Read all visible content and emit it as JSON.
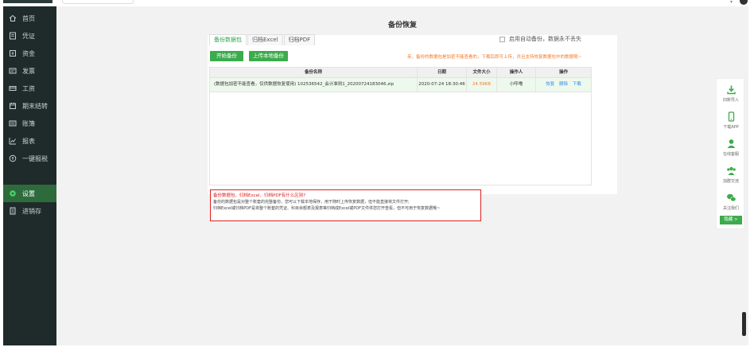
{
  "sidebar": {
    "items": [
      {
        "label": "首页",
        "icon": "home-icon"
      },
      {
        "label": "凭证",
        "icon": "voucher-icon"
      },
      {
        "label": "资金",
        "icon": "fund-icon"
      },
      {
        "label": "发票",
        "icon": "invoice-icon"
      },
      {
        "label": "工资",
        "icon": "salary-icon"
      },
      {
        "label": "期末结转",
        "icon": "period-end-icon"
      },
      {
        "label": "账簿",
        "icon": "ledger-icon"
      },
      {
        "label": "报表",
        "icon": "report-icon"
      },
      {
        "label": "一键报税",
        "icon": "tax-icon"
      },
      {
        "label": "设置",
        "icon": "settings-icon"
      },
      {
        "label": "进销存",
        "icon": "inventory-icon"
      }
    ],
    "active_index": 9
  },
  "page": {
    "title": "备份恢复",
    "tabs": [
      "备份数据包",
      "归档Excel",
      "归档PDF"
    ],
    "active_tab": 0,
    "auto_backup_label": "启用自动备份，数据永不丢失",
    "start_backup_label": "开始备份",
    "upload_backup_label": "上传本地备份",
    "notice": "亲，备份的数据包是加密不能查看的，下载后即可上传，并且支持恢复数据包中的数据哦~"
  },
  "table": {
    "headers": [
      "备份名称",
      "日期",
      "文件大小",
      "操作人",
      "操作"
    ],
    "rows": [
      {
        "name": "(数据包加密不能查看，仅供数据恢复使用) 102536542_会计准则1_20200724183046.zip",
        "date": "2020-07-24 18:30:46",
        "size": "24.59KB",
        "operator": "小呼噜",
        "actions": [
          "恢复",
          "删除",
          "下载"
        ]
      }
    ]
  },
  "faq": {
    "question": "备份数据包、归档Excel、归档PDF有什么区别?",
    "answer1": "备份的数据包是对整个账套的完整备份。您可以下载本地保存，用于随时上传恢复数据，但不能直接将文件打开;",
    "answer2": "归档Excel或归档PDF是将整个账套的凭证、科目余额表及报表等归档成Excel或PDF文件供您打开查看，但不可用于恢复数据哦~"
  },
  "rightbar": {
    "items": [
      {
        "label": "旧账导入",
        "icon": "download-import-icon"
      },
      {
        "label": "下载APP",
        "icon": "mobile-icon"
      },
      {
        "label": "在线客服",
        "icon": "customer-service-icon"
      },
      {
        "label": "加群交流",
        "icon": "group-icon"
      },
      {
        "label": "关注我们",
        "icon": "wechat-icon"
      }
    ],
    "more_label": "隐藏 >"
  },
  "colors": {
    "sidebar_bg": "#1f2b2b",
    "sidebar_active": "#2e6b3c",
    "accent_green": "#3cab4c",
    "notice_orange": "#f07a2a",
    "faq_red": "#e02020",
    "link_blue": "#2d8cf0"
  }
}
